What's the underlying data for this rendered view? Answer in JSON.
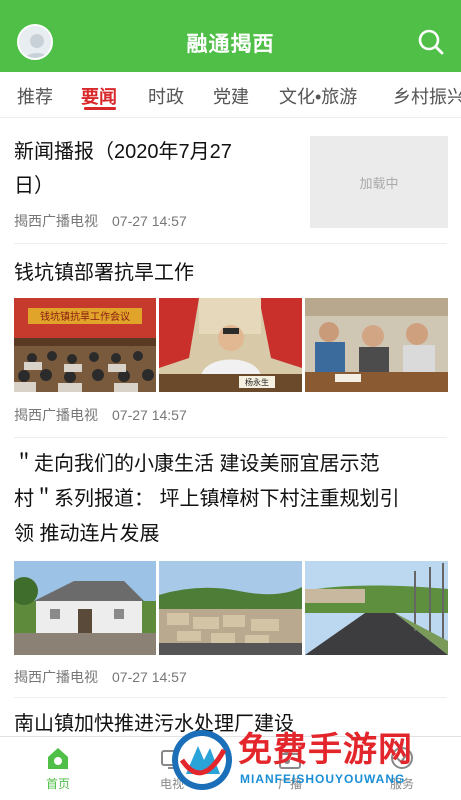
{
  "header": {
    "title": "融通揭西"
  },
  "tabs": [
    {
      "label": "推荐"
    },
    {
      "label": "要闻"
    },
    {
      "label": "时政"
    },
    {
      "label": "党建"
    },
    {
      "label": "文化•旅游"
    },
    {
      "label": "乡村振兴"
    }
  ],
  "articles": [
    {
      "title_line1": "新闻播报（2020年7月27",
      "title_line2": "日）",
      "placeholder": "加载中",
      "source": "揭西广播电视",
      "time": "07-27 14:57"
    },
    {
      "title": "钱坑镇部署抗旱工作",
      "banner": "钱坑镇抗旱工作会议",
      "nameplate": "杨永生",
      "source": "揭西广播电视",
      "time": "07-27 14:57"
    },
    {
      "title_line1": "＂走向我们的小康生活  建设美丽宜居示范",
      "title_line2": "村＂系列报道：  坪上镇樟树下村注重规划引",
      "title_line3": "领  推动连片发展",
      "source": "揭西广播电视",
      "time": "07-27 14:57"
    },
    {
      "title": "南山镇加快推进污水处理厂建设"
    }
  ],
  "bottom_nav": [
    {
      "label": "首页"
    },
    {
      "label": "电视"
    },
    {
      "label": "广播"
    },
    {
      "label": "服务"
    }
  ],
  "watermark": {
    "text": "免费手游网",
    "sub": "MIANFEISHOUYOUWANG"
  },
  "colors": {
    "brand_green": "#4fbf47",
    "active_red": "#d8282a"
  }
}
